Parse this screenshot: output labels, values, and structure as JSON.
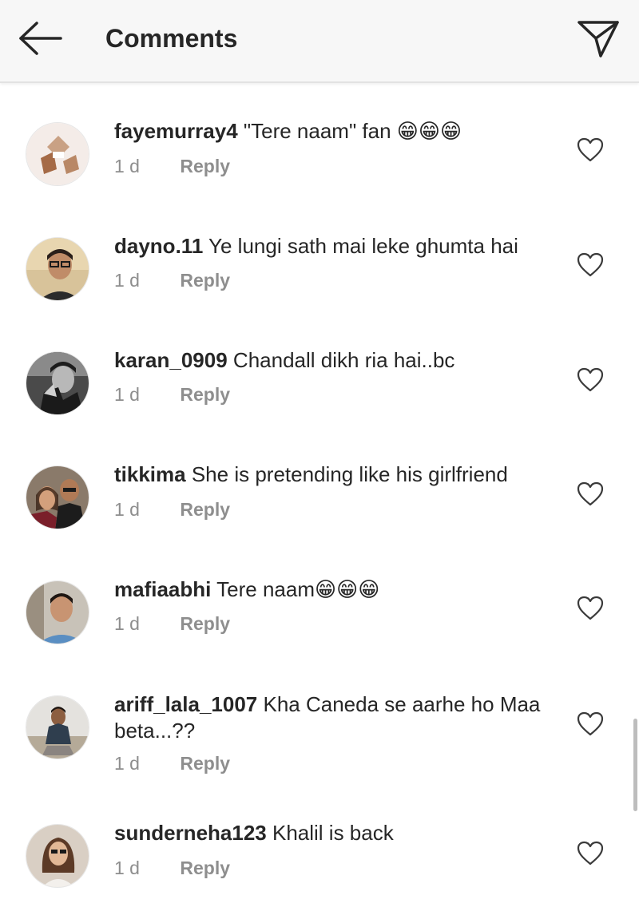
{
  "header": {
    "title": "Comments",
    "back_icon": "arrow-left-icon",
    "share_icon": "paper-plane-icon"
  },
  "comments": [
    {
      "username": "fayemurray4",
      "text": "\"Tere naam\" fan 😁😁😁",
      "time": "1 d",
      "reply_label": "Reply"
    },
    {
      "username": "dayno.11",
      "text": "Ye lungi sath mai leke ghumta hai",
      "time": "1 d",
      "reply_label": "Reply"
    },
    {
      "username": "karan_0909",
      "text": "Chandall dikh ria hai..bc",
      "time": "1 d",
      "reply_label": "Reply"
    },
    {
      "username": "tikkima",
      "text": "She is pretending like his girlfriend",
      "time": "1 d",
      "reply_label": "Reply"
    },
    {
      "username": "mafiaabhi",
      "text": "Tere naam😁😁😁",
      "time": "1 d",
      "reply_label": "Reply"
    },
    {
      "username": "ariff_lala_1007",
      "text": "Kha Caneda se aarhe ho Maa beta...??",
      "time": "1 d",
      "reply_label": "Reply"
    },
    {
      "username": "sunderneha123",
      "text": "Khalil is back",
      "time": "1 d",
      "reply_label": "Reply"
    }
  ],
  "colors": {
    "text": "#262626",
    "meta": "#8e8e8e",
    "header_bg": "#f7f7f7"
  }
}
